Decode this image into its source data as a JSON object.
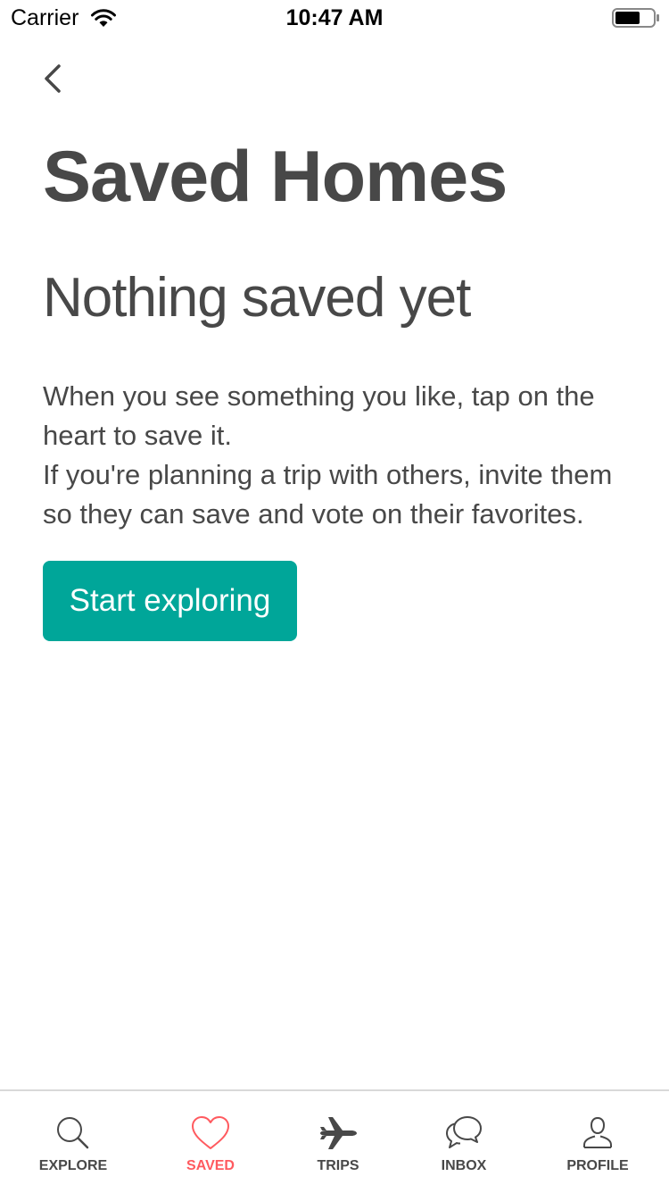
{
  "status_bar": {
    "carrier": "Carrier",
    "time": "10:47 AM"
  },
  "header": {
    "title": "Saved Homes"
  },
  "empty_state": {
    "heading": "Nothing saved yet",
    "line1": "When you see something you like, tap on the heart to save it.",
    "line2": "If you're planning a trip with others, invite them so they can save and vote on their favorites.",
    "cta_label": "Start exploring"
  },
  "tab_bar": {
    "items": [
      {
        "label": "EXPLORE",
        "icon": "search-icon"
      },
      {
        "label": "SAVED",
        "icon": "heart-icon"
      },
      {
        "label": "TRIPS",
        "icon": "airplane-icon"
      },
      {
        "label": "INBOX",
        "icon": "chat-bubbles-icon"
      },
      {
        "label": "PROFILE",
        "icon": "person-icon"
      }
    ],
    "active": "SAVED"
  },
  "colors": {
    "accent": "#00a699",
    "active_tab": "#ff5a5f",
    "text": "#484848"
  }
}
